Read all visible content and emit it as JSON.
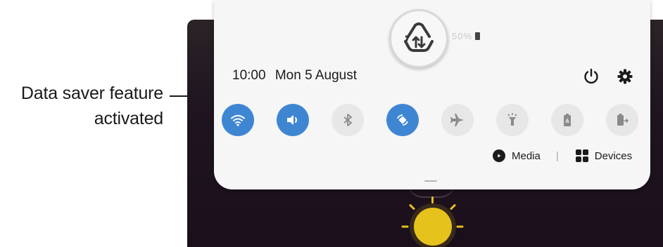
{
  "callout": {
    "line1": "Data saver feature",
    "line2": "activated"
  },
  "status_bar": {
    "battery_text": "50%",
    "icons": [
      "signal-icon",
      "battery-icon"
    ]
  },
  "panel": {
    "time": "10:00",
    "date": "Mon 5 August",
    "top_icons": [
      "power-icon",
      "gear-icon"
    ],
    "quick_toggles": [
      {
        "name": "wifi",
        "icon": "wifi-icon",
        "state": "on"
      },
      {
        "name": "sound",
        "icon": "volume-icon",
        "state": "on"
      },
      {
        "name": "bluetooth",
        "icon": "bluetooth-icon",
        "state": "off"
      },
      {
        "name": "auto-rotate",
        "icon": "rotate-icon",
        "state": "on"
      },
      {
        "name": "airplane-mode",
        "icon": "airplane-icon",
        "state": "off"
      },
      {
        "name": "flashlight",
        "icon": "flashlight-icon",
        "state": "off"
      },
      {
        "name": "power-saving",
        "icon": "battery-recycle-icon",
        "state": "off"
      },
      {
        "name": "wireless-powershare",
        "icon": "battery-share-icon",
        "state": "off"
      }
    ],
    "media_label": "Media",
    "separator": "|",
    "devices_label": "Devices"
  },
  "magnifier": {
    "icon": "data-saver-icon"
  },
  "colors": {
    "accent": "#3f86d2",
    "toggle_off_bg": "#e7e7e7",
    "panel_bg": "#f6f6f6",
    "wallpaper": "#1f1420",
    "sun": "#e6c21c"
  }
}
